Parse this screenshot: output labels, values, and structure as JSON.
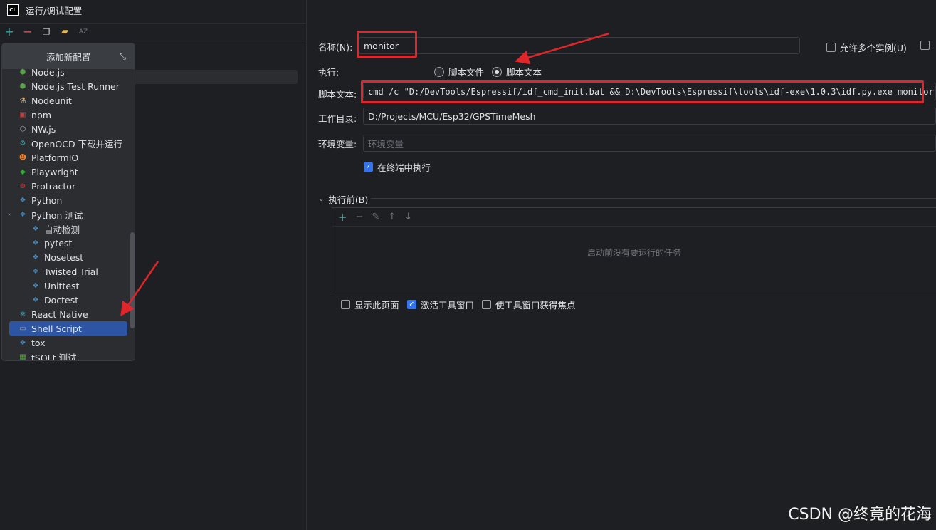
{
  "window": {
    "logo_text": "CL",
    "title": "运行/调试配置"
  },
  "toolbar": {
    "add": "+",
    "remove": "−",
    "sort": "AZ"
  },
  "popup": {
    "header": "添加新配置",
    "items": [
      {
        "label": "Node.js",
        "icon": "nodejs-icon",
        "color": "#5fa04e"
      },
      {
        "label": "Node.js Test Runner",
        "icon": "nodejs-test-icon",
        "color": "#5fa04e"
      },
      {
        "label": "Nodeunit",
        "icon": "nodeunit-icon",
        "color": "#e0b45c"
      },
      {
        "label": "npm",
        "icon": "npm-icon",
        "color": "#cb3837"
      },
      {
        "label": "NW.js",
        "icon": "nwjs-icon",
        "color": "#9aa5b5"
      },
      {
        "label": "OpenOCD 下载并运行",
        "icon": "openocd-icon",
        "color": "#3ea2a2"
      },
      {
        "label": "PlatformIO",
        "icon": "platformio-icon",
        "color": "#f5822a"
      },
      {
        "label": "Playwright",
        "icon": "playwright-icon",
        "color": "#2ead33"
      },
      {
        "label": "Protractor",
        "icon": "protractor-icon",
        "color": "#e23237"
      },
      {
        "label": "Python",
        "icon": "python-icon",
        "color": "#4b8bbe"
      },
      {
        "label": "Python 测试",
        "icon": "python-test-icon",
        "color": "#4b8bbe"
      },
      {
        "label": "自动检测",
        "icon": "python-icon",
        "color": "#4b8bbe"
      },
      {
        "label": "pytest",
        "icon": "python-icon",
        "color": "#4b8bbe"
      },
      {
        "label": "Nosetest",
        "icon": "python-icon",
        "color": "#4b8bbe"
      },
      {
        "label": "Twisted Trial",
        "icon": "python-icon",
        "color": "#4b8bbe"
      },
      {
        "label": "Unittest",
        "icon": "python-icon",
        "color": "#4b8bbe"
      },
      {
        "label": "Doctest",
        "icon": "python-icon",
        "color": "#4b8bbe"
      },
      {
        "label": "React Native",
        "icon": "react-icon",
        "color": "#61dafb"
      },
      {
        "label": "Shell Script",
        "icon": "terminal-icon",
        "color": "#9da0a8"
      },
      {
        "label": "tox",
        "icon": "python-icon",
        "color": "#4b8bbe"
      },
      {
        "label": "tSQLt 测试",
        "icon": "tsqlt-icon",
        "color": "#5fa04e"
      }
    ]
  },
  "form": {
    "name_label": "名称(N):",
    "name_value": "monitor",
    "allow_multiple": "允许多个实例(U)",
    "execute_label": "执行:",
    "radio_script_file": "脚本文件",
    "radio_script_text": "脚本文本",
    "script_text_label": "脚本文本:",
    "script_text_value": "cmd /c \"D:/DevTools/Espressif/idf_cmd_init.bat && D:\\DevTools\\Espressif\\tools\\idf-exe\\1.0.3\\idf.py.exe monitor\"",
    "workdir_label": "工作目录:",
    "workdir_value": "D:/Projects/MCU/Esp32/GPSTimeMesh",
    "env_label": "环境变量:",
    "env_placeholder": "环境变量",
    "run_in_terminal": "在终端中执行",
    "before_launch": "执行前(B)",
    "no_tasks": "启动前没有要运行的任务",
    "show_page": "显示此页面",
    "activate_tool_window": "激活工具窗口",
    "focus_tool_window": "使工具窗口获得焦点"
  },
  "watermark": "CSDN @终竟的花海",
  "colors": {
    "accent": "#3574f0",
    "selection": "#2e55a3",
    "annotation_red": "#e0262a"
  }
}
